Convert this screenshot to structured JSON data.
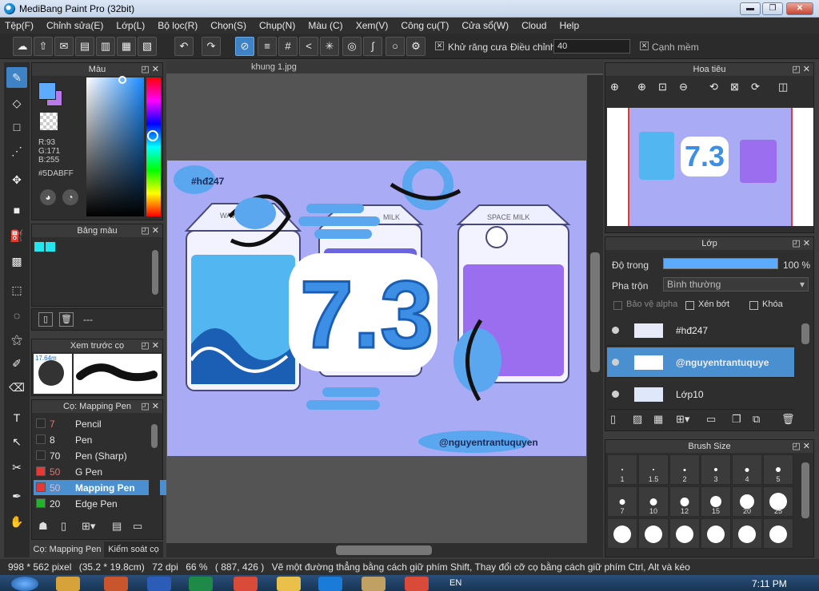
{
  "window": {
    "title": "MediBang Paint Pro (32bit)",
    "min": "▬",
    "max": "❐",
    "close": "✕"
  },
  "menu": [
    "Tệp(F)",
    "Chỉnh sửa(E)",
    "Lớp(L)",
    "Bộ lọc(R)",
    "Chọn(S)",
    "Chụp(N)",
    "Màu (C)",
    "Xem(V)",
    "Công cụ(T)",
    "Cửa sổ(W)",
    "Cloud",
    "Help"
  ],
  "toolbar": {
    "antialias_label": "Khử răng cưa",
    "correction_label": "Điều chỉnh",
    "correction_value": "40",
    "smooth_label": "Cạnh mềm",
    "check": "✕"
  },
  "color_panel": {
    "title": "Màu",
    "r": "R:93",
    "g": "G:171",
    "b": "B:255",
    "hex": "#5DABFF",
    "fg_color": "#5DABFF",
    "bg_color": "#B87AE6"
  },
  "palette_panel": {
    "title": "Bảng màu",
    "count": "---"
  },
  "brush_preview": {
    "title": "Xem trước cọ",
    "size": "17.64m"
  },
  "brush_panel": {
    "title": "Cọ: Mapping Pen",
    "items": [
      {
        "num": "7",
        "name": "Pencil",
        "color": "#2a2a2a"
      },
      {
        "num": "8",
        "name": "Pen",
        "color": "#2a2a2a"
      },
      {
        "num": "70",
        "name": "Pen (Sharp)",
        "color": "#2a2a2a"
      },
      {
        "num": "50",
        "name": "G Pen",
        "color": "#e53935"
      },
      {
        "num": "50",
        "name": "Mapping Pen",
        "color": "#e53935"
      },
      {
        "num": "20",
        "name": "Edge Pen",
        "color": "#22b22b"
      }
    ],
    "tab1": "Cọ: Mapping Pen",
    "tab2": "Kiểm soát cọ"
  },
  "document": {
    "tab": "khung 1.jpg"
  },
  "artwork": {
    "hashtag": "#hđ247",
    "big_text": "7.3",
    "watermark": "@nguyentrantuquyen",
    "label_left": "WAVE",
    "label_mid": "MILK",
    "label_right": "SPACE MILK"
  },
  "navigator": {
    "title": "Hoa tiêu"
  },
  "layer_panel": {
    "title": "Lớp",
    "opacity_label": "Độ trong",
    "opacity_value": "100 %",
    "blend_label": "Pha trộn",
    "blend_value": "Bình thường",
    "protect_alpha": "Bảo vệ alpha",
    "clipping": "Xén bớt",
    "lock": "Khóa",
    "layers": [
      "#hđ247",
      "@nguyentrantuquye",
      "Lớp10"
    ]
  },
  "brush_size": {
    "title": "Brush Size",
    "sizes": [
      "1",
      "1.5",
      "2",
      "3",
      "4",
      "5",
      "7",
      "10",
      "12",
      "15",
      "20",
      "25",
      "",
      "",
      "",
      "",
      "",
      ""
    ]
  },
  "status": {
    "dims": "998 * 562 pixel",
    "cm": "(35.2 * 19.8cm)",
    "dpi": "72 dpi",
    "zoom": "66 %",
    "coords": "( 887, 426 )",
    "hint": "Vẽ một đường thẳng bằng cách giữ phím Shift, Thay đổi cỡ cọ bằng cách giữ phím Ctrl, Alt và kéo"
  },
  "taskbar": {
    "lang": "EN",
    "time": "7:11 PM"
  }
}
